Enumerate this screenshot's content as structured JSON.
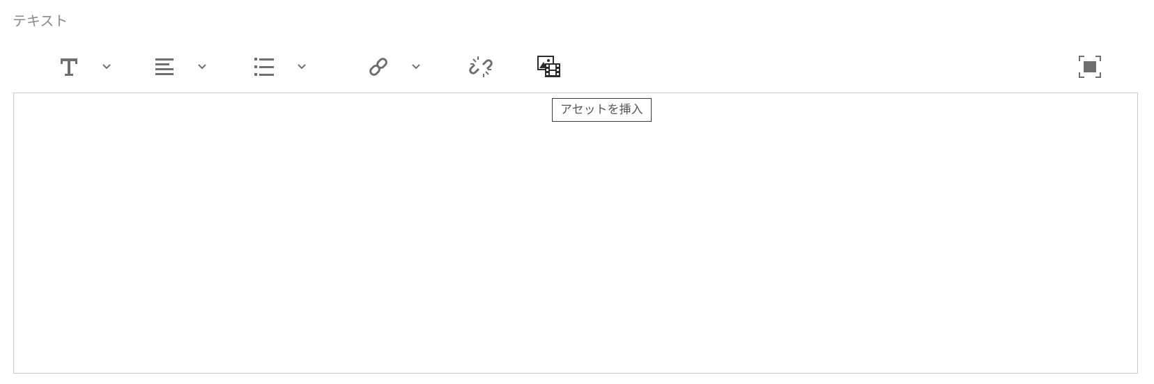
{
  "field": {
    "label": "テキスト"
  },
  "toolbar": {
    "items": [
      {
        "name": "text-format",
        "icon": "text-format-icon",
        "has_dropdown": true
      },
      {
        "name": "alignment",
        "icon": "align-left-icon",
        "has_dropdown": true
      },
      {
        "name": "list",
        "icon": "bulleted-list-icon",
        "has_dropdown": true
      },
      {
        "name": "link",
        "icon": "link-icon",
        "has_dropdown": true
      },
      {
        "name": "unlink",
        "icon": "unlink-icon",
        "has_dropdown": false
      },
      {
        "name": "insert-asset",
        "icon": "insert-asset-icon",
        "has_dropdown": false
      },
      {
        "name": "fullscreen",
        "icon": "fullscreen-icon",
        "has_dropdown": false
      }
    ]
  },
  "tooltip": {
    "text": "アセットを挿入"
  },
  "editor": {
    "content": ""
  },
  "colors": {
    "icon": "#6e6e6e",
    "icon_active": "#2b2b2b",
    "label": "#8a8a8a",
    "border": "#c8c8c8",
    "tooltip_border": "#3a3a3a"
  }
}
